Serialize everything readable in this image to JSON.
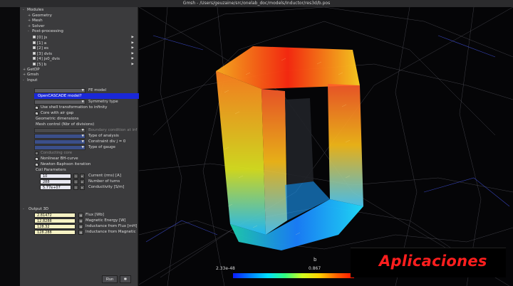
{
  "window": {
    "title": "Gmsh - /Users/geuzaine/src/onelab_doc/models/Inductor/res3d/b.pos"
  },
  "tree": [
    {
      "label": "Modules",
      "exp": "-"
    },
    {
      "label": "Geometry",
      "exp": "+",
      "indent": 1
    },
    {
      "label": "Mesh",
      "exp": "+",
      "indent": 1
    },
    {
      "label": "Solver",
      "exp": "+",
      "indent": 1
    },
    {
      "label": "Post-processing",
      "exp": "-",
      "indent": 1
    },
    {
      "label": "[0] js",
      "indent": 2,
      "arrow": true
    },
    {
      "label": "[1] a",
      "indent": 2,
      "arrow": true
    },
    {
      "label": "[2] es",
      "indent": 2,
      "arrow": true
    },
    {
      "label": "[3] dvis",
      "indent": 2,
      "arrow": true
    },
    {
      "label": "[4] js0_dvis",
      "indent": 2,
      "arrow": true
    },
    {
      "label": "[5] b",
      "indent": 2,
      "arrow": true
    },
    {
      "label": "GetDP",
      "exp": "+"
    },
    {
      "label": "Gmsh",
      "exp": "+"
    },
    {
      "label": "Input",
      "exp": "-"
    }
  ],
  "input": {
    "fe_model": "FE model",
    "opencascade": "OpenCASCADE model?",
    "symmetry_type": "Symmetry type",
    "use_shell": "Use shell transformation to infinity",
    "core_air_gap": "Core with air gap",
    "geom_dims": "Geometric dimensions",
    "mesh_control": "Mesh control (Nbr of divisions)",
    "boundary_condition": "Boundary condition at inf",
    "type_analysis": "Type of analysis",
    "constraint_div": "Constraint div j = 0",
    "type_gauge": "Type of gauge",
    "conducting_core": "Conducting core",
    "nonlinear_bh": "Nonlinear BH-curve",
    "newton_raphson": "Newton-Raphson iteration",
    "coil_params": "Coil Parameters",
    "current_value": "10",
    "current_label": "Current (rms) [A]",
    "turns_value": "288",
    "turns_label": "Number of turns",
    "conductivity_value": "5.77e+07",
    "conductivity_label": "Conductivity [S/m]"
  },
  "output": {
    "header": "Output 3D",
    "rows": [
      {
        "value": "2.81472",
        "label": "Flux [Wb]"
      },
      {
        "value": "12.8288",
        "label": "Magnetic Energy [W]"
      },
      {
        "value": "128.32",
        "label": "Inductance from Flux [mH]"
      },
      {
        "value": "128.288",
        "label": "Inductance from Magnetic"
      }
    ]
  },
  "buttons": {
    "run": "Run",
    "gear": "✱"
  },
  "colorbar": {
    "title": "b",
    "min": "2.33e-48",
    "max": "0.867"
  },
  "brand": {
    "text": "Aplicaciones",
    "color": "#ff1e1e"
  }
}
